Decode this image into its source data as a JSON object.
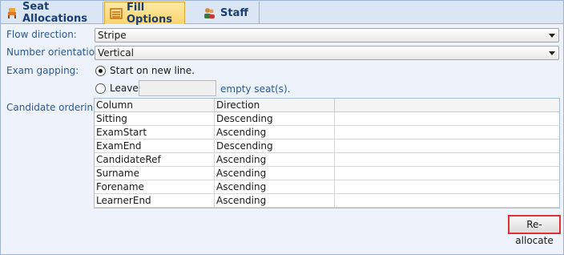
{
  "tabs": [
    {
      "label": "Seat Allocations",
      "icon": "seat-icon"
    },
    {
      "label": "Fill Options",
      "icon": "fill-options-icon"
    },
    {
      "label": "Staff",
      "icon": "staff-icon"
    }
  ],
  "form": {
    "flow_direction_label": "Flow direction:",
    "flow_direction_value": "Stripe",
    "number_orientation_label": "Number orientation:",
    "number_orientation_value": "Vertical",
    "exam_gapping_label": "Exam gapping:",
    "gap_option_new_line": "Start on new line.",
    "gap_option_leave": "Leave",
    "gap_option_leave_value": "",
    "gap_option_suffix": "empty seat(s).",
    "candidate_ordering_label": "Candidate ordering:"
  },
  "grid": {
    "headers": [
      "Column",
      "Direction"
    ],
    "rows": [
      {
        "column": "Sitting",
        "direction": "Descending"
      },
      {
        "column": "ExamStart",
        "direction": "Ascending"
      },
      {
        "column": "ExamEnd",
        "direction": "Descending"
      },
      {
        "column": "CandidateRef",
        "direction": "Ascending"
      },
      {
        "column": "Surname",
        "direction": "Ascending"
      },
      {
        "column": "Forename",
        "direction": "Ascending"
      },
      {
        "column": "LearnerEnd",
        "direction": "Ascending"
      }
    ]
  },
  "actions": {
    "reallocate_label": "Re-allocate"
  },
  "colors": {
    "label_blue": "#2b5797",
    "active_tab": "#fbd56b",
    "highlight_border": "#e03030"
  }
}
